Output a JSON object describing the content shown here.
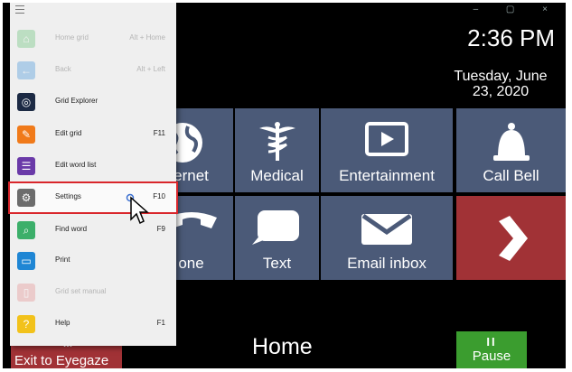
{
  "window_controls": "– ▢ ×",
  "clock": "2:36 PM",
  "date": "Tuesday, June 23, 2020",
  "grid_tiles": [
    {
      "label": "ernet",
      "icon": "globe-icon"
    },
    {
      "label": "Medical",
      "icon": "caduceus-icon"
    },
    {
      "label": "Entertainment",
      "icon": "play-icon"
    },
    {
      "label": "Call Bell",
      "icon": "bell-icon"
    },
    {
      "label": "one",
      "icon": "phone-icon"
    },
    {
      "label": "Text",
      "icon": "speech-bubble-icon"
    },
    {
      "label": "Email inbox",
      "icon": "envelope-icon"
    },
    {
      "label": "",
      "icon": "chevron-right-icon"
    }
  ],
  "footer": {
    "home_label": "Home",
    "exit_label": "Exit to Eyegaze",
    "exit_icon_char": "M",
    "pause_label": "Pause",
    "pause_icon_char": "II"
  },
  "menu": {
    "items": [
      {
        "label": "Home grid",
        "shortcut": "Alt + Home",
        "icon": "home-icon",
        "color": "#5fbf6f",
        "disabled": true
      },
      {
        "label": "Back",
        "shortcut": "Alt + Left",
        "icon": "back-icon",
        "color": "#3a8fd9",
        "disabled": true
      },
      {
        "label": "Grid Explorer",
        "shortcut": "",
        "icon": "compass-icon",
        "color": "#1c2a44",
        "disabled": false
      },
      {
        "label": "Edit grid",
        "shortcut": "F11",
        "icon": "pencil-icon",
        "color": "#f07a1a",
        "disabled": false
      },
      {
        "label": "Edit word list",
        "shortcut": "",
        "icon": "list-icon",
        "color": "#6a3aa8",
        "disabled": false
      },
      {
        "label": "Settings",
        "shortcut": "F10",
        "icon": "gear-icon",
        "color": "#6c6c6c",
        "disabled": false,
        "selected": true
      },
      {
        "label": "Find word",
        "shortcut": "F9",
        "icon": "search-icon",
        "color": "#3caf6a",
        "disabled": false
      },
      {
        "label": "Print",
        "shortcut": "",
        "icon": "printer-icon",
        "color": "#1f86d4",
        "disabled": false
      },
      {
        "label": "Grid set manual",
        "shortcut": "",
        "icon": "book-icon",
        "color": "#e58a8a",
        "disabled": true
      },
      {
        "label": "Help",
        "shortcut": "F1",
        "icon": "help-icon",
        "color": "#f2c21b",
        "disabled": false
      }
    ]
  },
  "colors": {
    "tile_blue": "#4b5a78",
    "tile_red": "#a13236",
    "pause_green": "#3b9d2f",
    "selection_outline": "#d9262b"
  }
}
